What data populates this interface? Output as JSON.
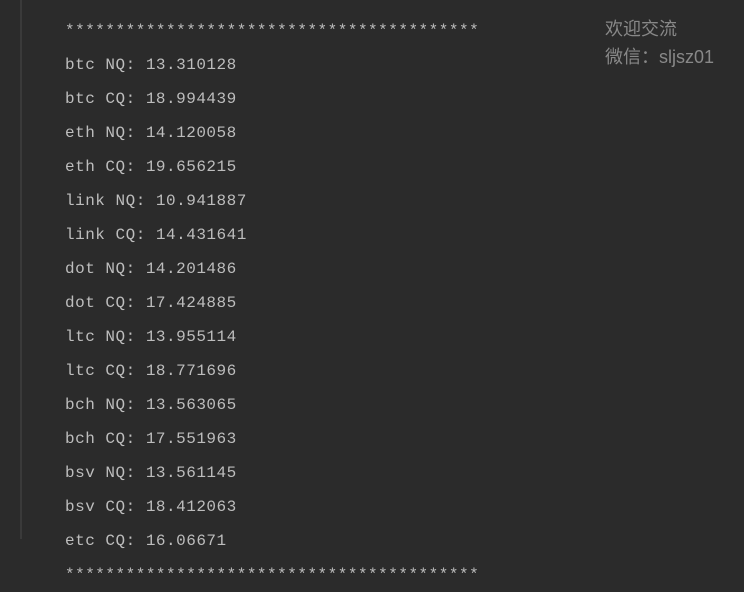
{
  "separator": "*****************************************",
  "lines": [
    {
      "symbol": "btc",
      "type": "NQ",
      "value": "13.310128"
    },
    {
      "symbol": "btc",
      "type": "CQ",
      "value": "18.994439"
    },
    {
      "symbol": "eth",
      "type": "NQ",
      "value": "14.120058"
    },
    {
      "symbol": "eth",
      "type": "CQ",
      "value": "19.656215"
    },
    {
      "symbol": "link",
      "type": "NQ",
      "value": "10.941887"
    },
    {
      "symbol": "link",
      "type": "CQ",
      "value": "14.431641"
    },
    {
      "symbol": "dot",
      "type": "NQ",
      "value": "14.201486"
    },
    {
      "symbol": "dot",
      "type": "CQ",
      "value": "17.424885"
    },
    {
      "symbol": "ltc",
      "type": "NQ",
      "value": "13.955114"
    },
    {
      "symbol": "ltc",
      "type": "CQ",
      "value": "18.771696"
    },
    {
      "symbol": "bch",
      "type": "NQ",
      "value": "13.563065"
    },
    {
      "symbol": "bch",
      "type": "CQ",
      "value": "17.551963"
    },
    {
      "symbol": "bsv",
      "type": "NQ",
      "value": "13.561145"
    },
    {
      "symbol": "bsv",
      "type": "CQ",
      "value": "18.412063"
    },
    {
      "symbol": "etc",
      "type": "CQ",
      "value": "16.06671"
    }
  ],
  "watermark": {
    "line1": "欢迎交流",
    "line2": "微信：sljsz01"
  }
}
